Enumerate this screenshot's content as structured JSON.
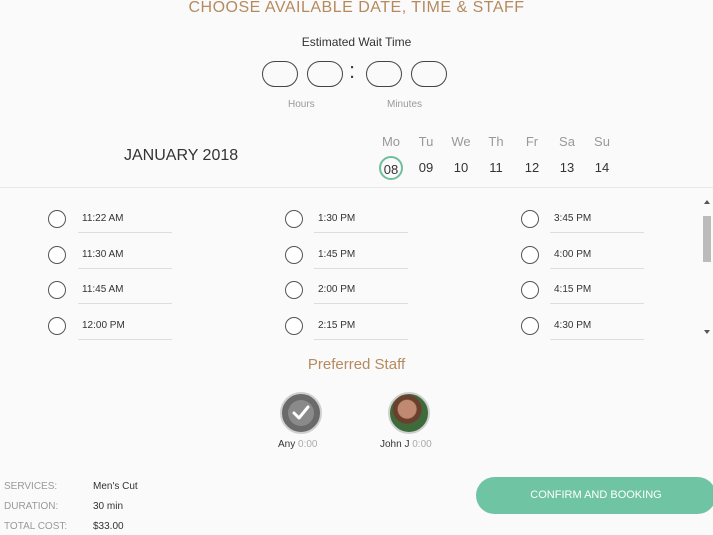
{
  "header": {
    "title": "CHOOSE AVAILABLE DATE, TIME & STAFF",
    "back_icon": "chevron-left-icon"
  },
  "wait_time": {
    "title": "Estimated Wait Time",
    "separator": ":",
    "hours_label": "Hours",
    "minutes_label": "Minutes"
  },
  "calendar": {
    "month": "JANUARY 2018",
    "days": [
      {
        "name": "Mo",
        "num": "08",
        "selected": true
      },
      {
        "name": "Tu",
        "num": "09"
      },
      {
        "name": "We",
        "num": "10"
      },
      {
        "name": "Th",
        "num": "11"
      },
      {
        "name": "Fr",
        "num": "12"
      },
      {
        "name": "Sa",
        "num": "13"
      },
      {
        "name": "Su",
        "num": "14"
      }
    ]
  },
  "time_slots": {
    "columns": [
      [
        "11:22 AM",
        "11:30 AM",
        "11:45 AM",
        "12:00 PM"
      ],
      [
        "1:30 PM",
        "1:45 PM",
        "2:00 PM",
        "2:15 PM"
      ],
      [
        "3:45 PM",
        "4:00 PM",
        "4:15 PM",
        "4:30 PM"
      ]
    ]
  },
  "staff": {
    "title": "Preferred Staff",
    "members": [
      {
        "name": "Any",
        "time": "0:00"
      },
      {
        "name": "John J",
        "time": "0:00"
      }
    ]
  },
  "summary": {
    "services_key": "SERVICES:",
    "services_val": "Men's Cut",
    "duration_key": "DURATION:",
    "duration_val": "30 min",
    "cost_key": "TOTAL COST:",
    "cost_val": "$33.00"
  },
  "actions": {
    "confirm_label": "CONFIRM AND BOOKING"
  },
  "colors": {
    "accent": "#6fc4a3",
    "title": "#b58a5e"
  }
}
